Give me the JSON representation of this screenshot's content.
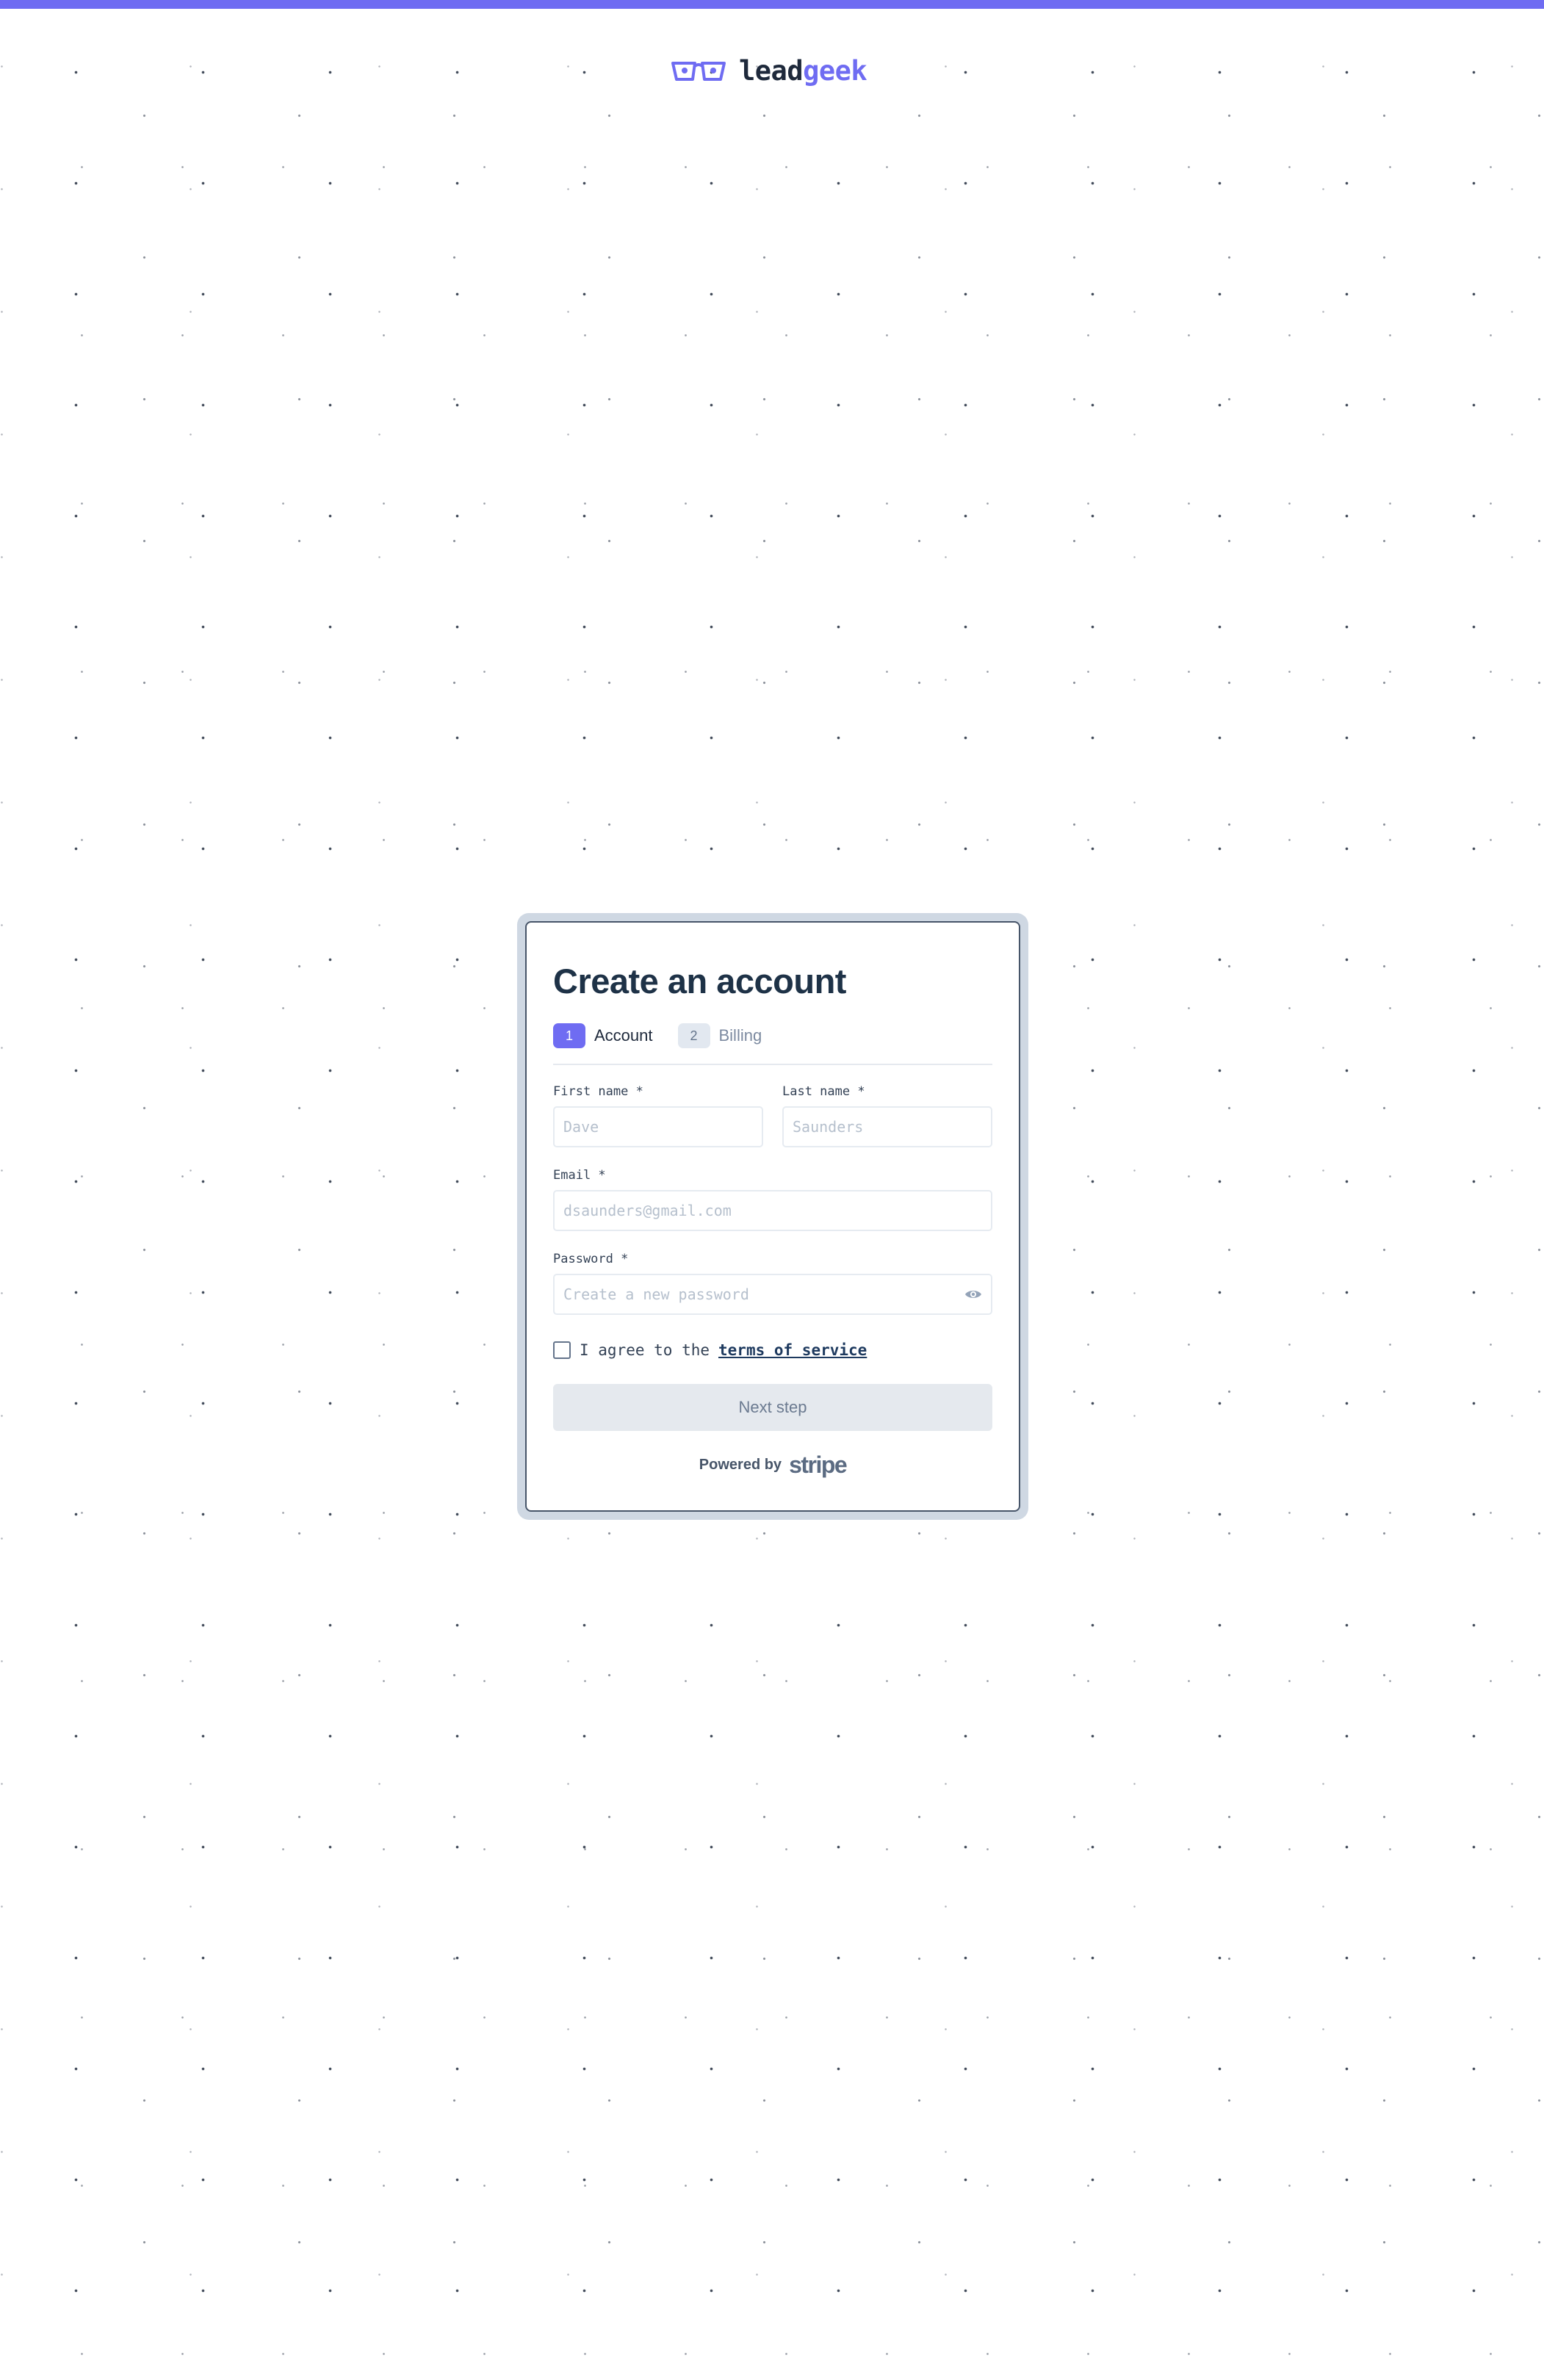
{
  "brand": {
    "name_part1": "lead",
    "name_part2": "geek",
    "accent_color": "#6f6cf2",
    "logo_icon": "glasses-icon"
  },
  "form": {
    "title": "Create an account",
    "steps": [
      {
        "number": "1",
        "label": "Account",
        "active": true
      },
      {
        "number": "2",
        "label": "Billing",
        "active": false
      }
    ],
    "fields": {
      "first_name": {
        "label": "First name *",
        "placeholder": "Dave",
        "value": ""
      },
      "last_name": {
        "label": "Last name *",
        "placeholder": "Saunders",
        "value": ""
      },
      "email": {
        "label": "Email *",
        "placeholder": "dsaunders@gmail.com",
        "value": ""
      },
      "password": {
        "label": "Password *",
        "placeholder": "Create a new password",
        "value": "",
        "toggle_icon": "eye-icon"
      }
    },
    "agree": {
      "prefix": "I agree to the",
      "link_text": "terms of service",
      "checked": false
    },
    "next_button": "Next step",
    "powered_by": {
      "text": "Powered by",
      "brand": "stripe"
    }
  }
}
